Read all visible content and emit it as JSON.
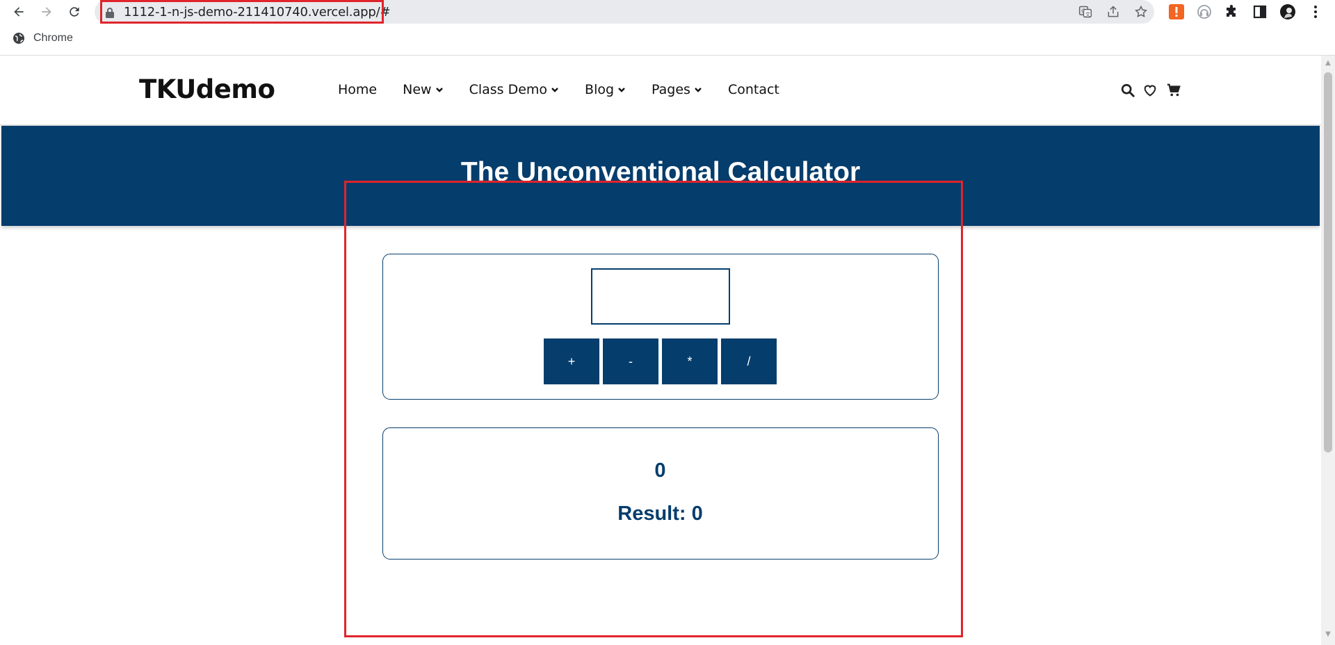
{
  "browser": {
    "url": "1112-1-n-js-demo-211410740.vercel.app/#",
    "bookmark_label": "Chrome"
  },
  "site": {
    "logo": "TKUdemo",
    "menu": [
      {
        "label": "Home",
        "has_dropdown": false
      },
      {
        "label": "New",
        "has_dropdown": true
      },
      {
        "label": "Class Demo",
        "has_dropdown": true
      },
      {
        "label": "Blog",
        "has_dropdown": true
      },
      {
        "label": "Pages",
        "has_dropdown": true
      },
      {
        "label": "Contact",
        "has_dropdown": false
      }
    ]
  },
  "calculator": {
    "title": "The Unconventional Calculator",
    "input_value": "",
    "operators": [
      "+",
      "-",
      "*",
      "/"
    ],
    "current_value": "0",
    "result_text": "Result: 0"
  },
  "colors": {
    "primary": "#053d6c",
    "highlight": "#e0242b"
  }
}
